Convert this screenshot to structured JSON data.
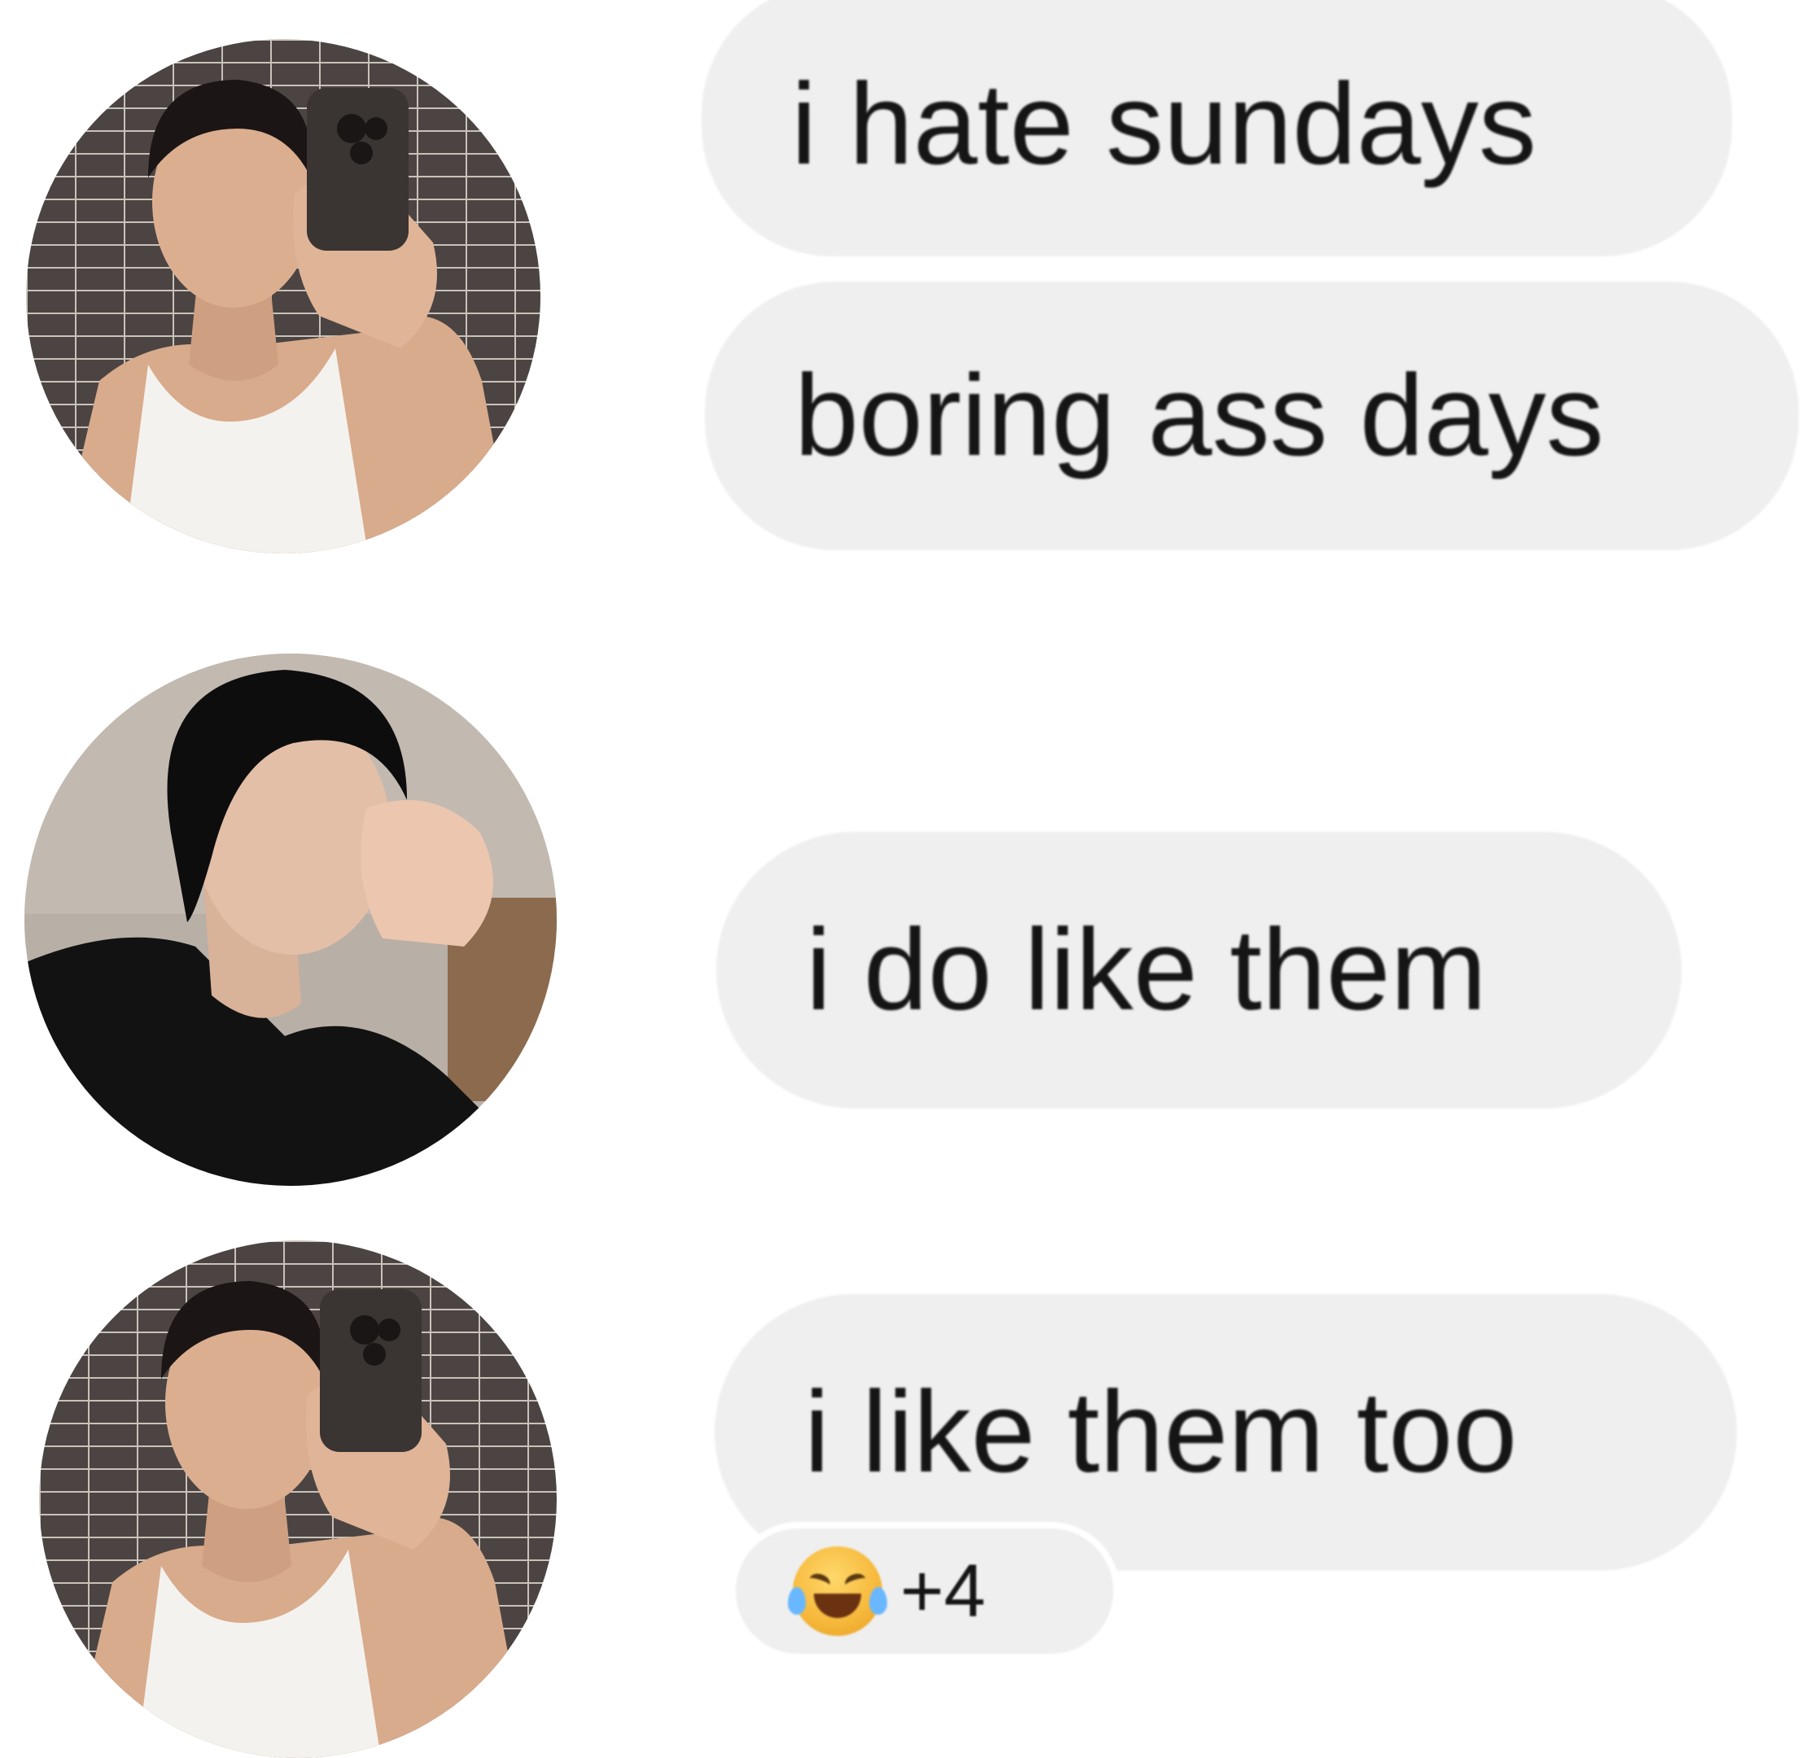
{
  "messages": [
    {
      "text": "i hate sundays"
    },
    {
      "text": "boring ass days"
    },
    {
      "text": "i do like them"
    },
    {
      "text": "i like them too"
    }
  ],
  "reaction": {
    "emoji_icon": "face-with-tears-of-joy-icon",
    "count": "+4"
  },
  "colors": {
    "bubble": "#efefef",
    "text": "#151515",
    "background": "#ffffff"
  }
}
